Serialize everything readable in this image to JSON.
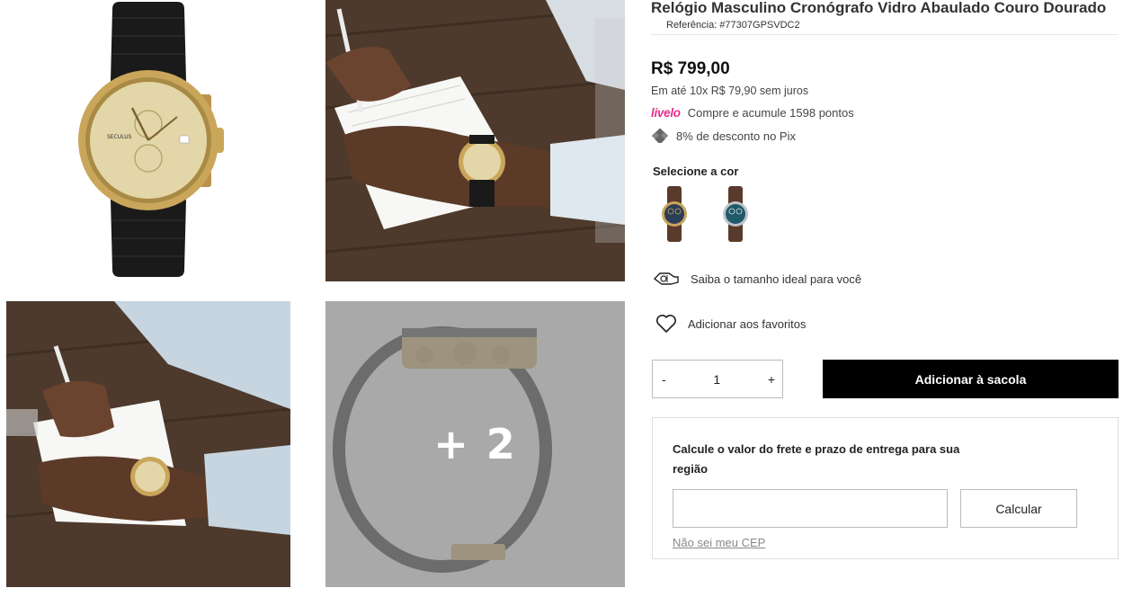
{
  "product": {
    "title": "Relógio Masculino Cronógrafo Vidro Abaulado Couro Dourado",
    "reference": "Referência: #77307GPSVDC2",
    "price": "R$ 799,00",
    "installments": "Em até 10x R$ 79,90 sem juros",
    "livelo_brand": "livelo",
    "livelo_text": "Compre e acumule 1598 pontos",
    "pix_text": "8% de desconto no Pix",
    "color_label": "Selecione a cor",
    "watch_brand": "SECULUS"
  },
  "gallery": {
    "more_count": "+ 2"
  },
  "actions": {
    "size_guide": "Saiba o tamanho ideal para você",
    "favorites": "Adicionar aos favoritos",
    "qty_minus": "-",
    "qty_value": "1",
    "qty_plus": "+",
    "add_to_bag": "Adicionar à sacola"
  },
  "shipping": {
    "title": "Calcule o valor do frete e prazo de entrega para sua região",
    "input_value": "",
    "calc_button": "Calcular",
    "unknown_cep_link": "Não sei meu CEP"
  },
  "colors": {
    "livelo": "#e62e8a",
    "gold": "#c9a65a",
    "wood": "#4a3628"
  }
}
